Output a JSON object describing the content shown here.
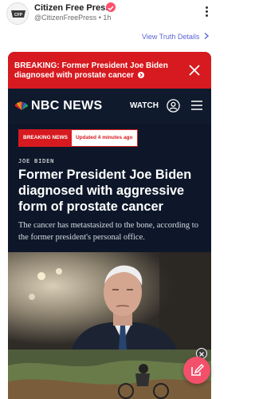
{
  "post": {
    "author_name": "Citizen Free Press",
    "author_handle": "@CitizenFreePress",
    "time_ago": "1h",
    "view_details": "View Truth Details"
  },
  "card": {
    "breaking_text": "BREAKING: Former President Joe Biden diagnosed with prostate cancer",
    "brand": "NBC NEWS",
    "watch_label": "WATCH",
    "tag_breaking": "BREAKING NEWS",
    "tag_updated": "Updated 4 minutes ago",
    "kicker": "JOE BIDEN",
    "headline": "Former President Joe Biden diagnosed with aggressive form of prostate cancer",
    "dek": "The cancer has metastasized to the bone, according to the former president's personal office."
  },
  "colors": {
    "breaking_red": "#d61a1f",
    "navy": "#0f1a2d",
    "fab_pink": "#f2506b",
    "link_blue": "#5b64d6"
  }
}
